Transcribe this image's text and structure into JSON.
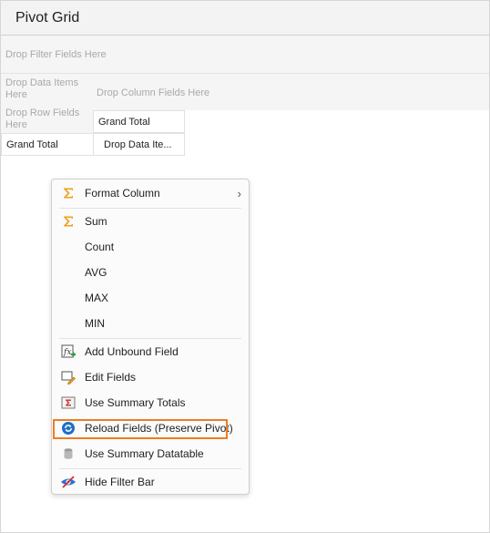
{
  "window": {
    "title": "Pivot Grid"
  },
  "grid": {
    "filter_hint": "Drop Filter Fields Here",
    "data_items_hint_line1": "Drop Data Items",
    "data_items_hint_line2": "Here",
    "column_hint": "Drop Column Fields Here",
    "row_hint_line1": "Drop Row Fields",
    "row_hint_line2": "Here",
    "col_header": "Grand Total",
    "row_header": "Grand Total",
    "data_cell": "Drop Data Ite..."
  },
  "context_menu": {
    "format_column": "Format Column",
    "sum": "Sum",
    "count": "Count",
    "avg": "AVG",
    "max": "MAX",
    "min": "MIN",
    "add_unbound_field": "Add Unbound Field",
    "edit_fields": "Edit Fields",
    "use_summary_totals": "Use Summary Totals",
    "reload_fields": "Reload Fields (Preserve Pivot)",
    "use_summary_datatable": "Use Summary Datatable",
    "hide_filter_bar": "Hide Filter Bar",
    "submenu_chevron": "›",
    "highlighted_item": "reload_fields"
  },
  "colors": {
    "accent_orange": "#ee7d22",
    "sigma_orange": "#f0a020",
    "reload_blue": "#1e6fc8"
  }
}
